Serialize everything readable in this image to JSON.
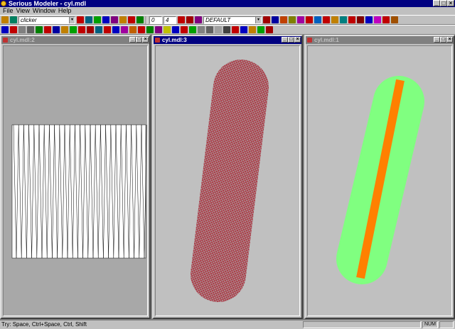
{
  "app": {
    "title": "Serious Modeler - cyl.mdl"
  },
  "window_buttons": {
    "minimize": "_",
    "maximize": "□",
    "close": "×"
  },
  "menu": [
    {
      "label": "File"
    },
    {
      "label": "View"
    },
    {
      "label": "Window"
    },
    {
      "label": "Help"
    }
  ],
  "toolbar": {
    "texture_combo": {
      "value": "clicker",
      "arrow": "▾"
    },
    "frame_start": "0",
    "frame_end": "4",
    "anim_combo": {
      "value": "DEFAULT",
      "arrow": "▾"
    }
  },
  "toolbar1_icon_colors": [
    "#c00000",
    "#006080",
    "#00a000",
    "#0000c0",
    "#800080",
    "#c08000",
    "#c00000",
    "#008000",
    "#a00000",
    "#0000a0",
    "#c04000",
    "#808000",
    "#a000a0",
    "#c00000",
    "#0060c0",
    "#c00000",
    "#c08000",
    "#008080",
    "#c00000",
    "#800000",
    "#0000c0",
    "#c000c0",
    "#c00000",
    "#a05000"
  ],
  "toolbar2_icon_colors": [
    "#0000c0",
    "#c00000",
    "#808080",
    "#606060",
    "#008000",
    "#c00000",
    "#0000a0",
    "#c08000",
    "#00a000",
    "#c00000",
    "#a00000",
    "#006080",
    "#c00000",
    "#0000c0",
    "#a000a0",
    "#c06000",
    "#c00000",
    "#008000",
    "#800080",
    "#c0c000",
    "#0000c0",
    "#c00000",
    "#00a000",
    "#808080",
    "#606060",
    "#a0a0a0",
    "#404040",
    "#c00000",
    "#0000c0",
    "#c08000",
    "#00a000",
    "#a00000"
  ],
  "windows": [
    {
      "title": "cyl.mdl:2",
      "active": false
    },
    {
      "title": "cyl.mdl:3",
      "active": true
    },
    {
      "title": "cyl.mdl:1",
      "active": false
    }
  ],
  "status": {
    "hint": "Try: Space, Ctrl+Space, Ctrl, Shift",
    "num": "NUM"
  },
  "colors": {
    "checker_a": "#b03040",
    "checker_b": "#a89090",
    "map_green": "#80ff80",
    "map_orange": "#ff8000",
    "title_active": "#000080"
  }
}
